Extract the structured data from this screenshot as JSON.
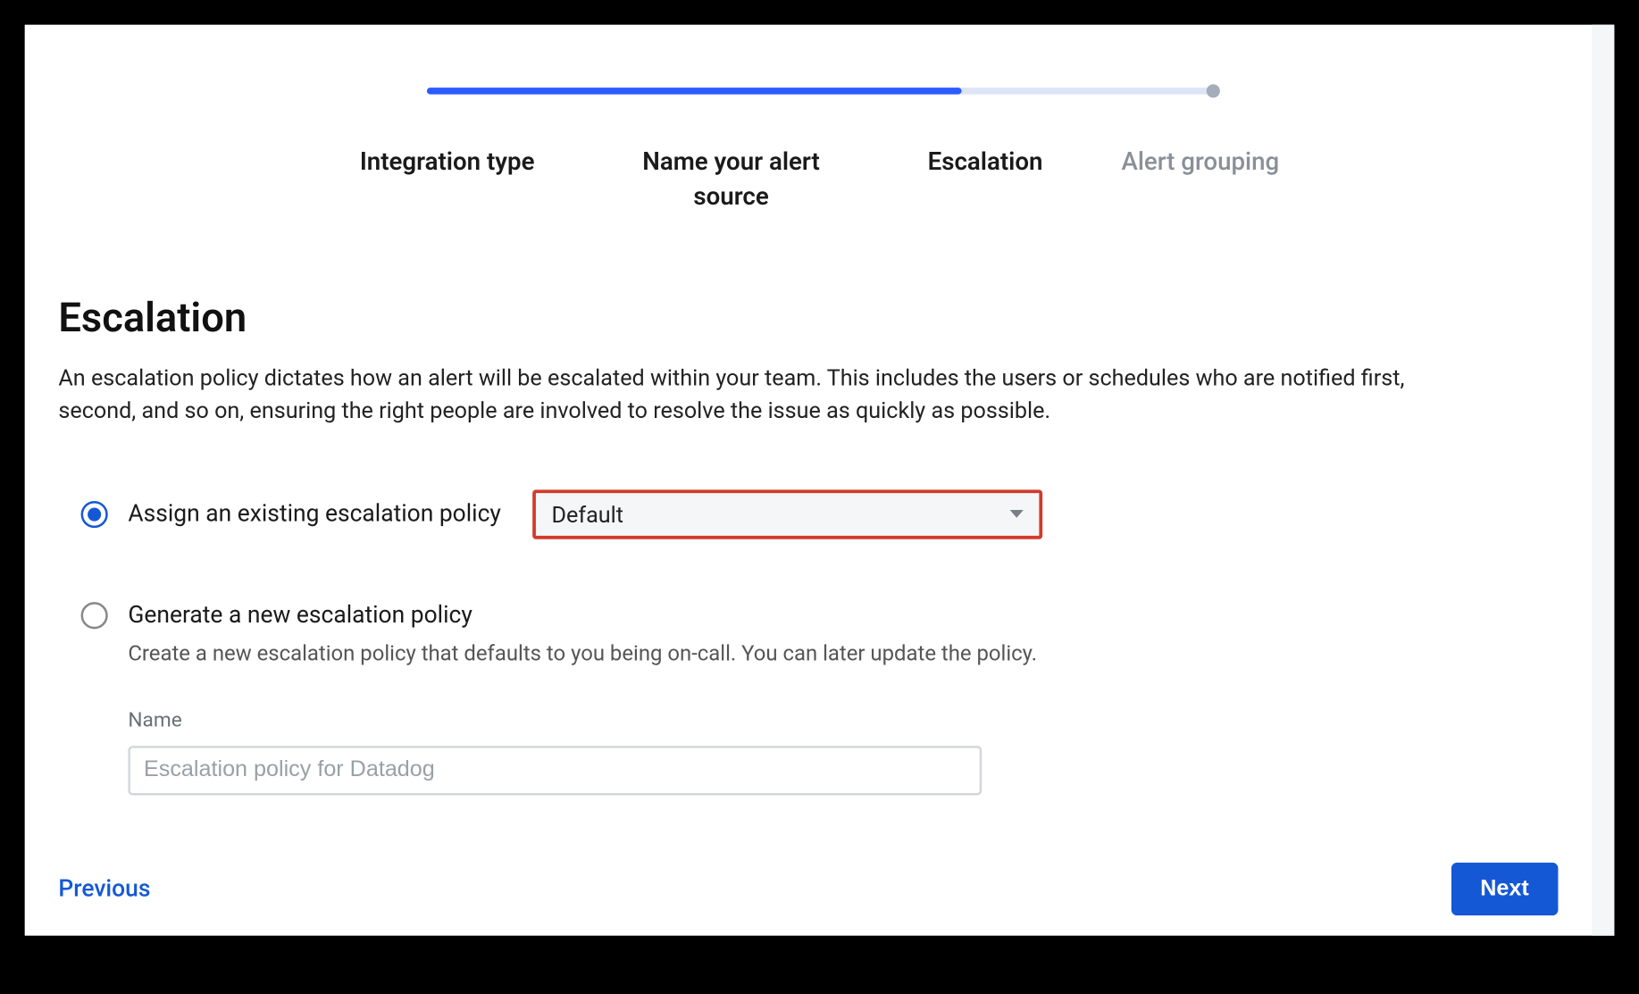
{
  "stepper": {
    "steps": [
      {
        "label": "Integration type",
        "active": true
      },
      {
        "label": "Name your alert source",
        "active": true
      },
      {
        "label": "Escalation",
        "active": true
      },
      {
        "label": "Alert grouping",
        "active": false
      }
    ]
  },
  "heading": {
    "title": "Escalation",
    "description": "An escalation policy dictates how an alert will be escalated within your team. This includes the users or schedules who are notified first, second, and so on, ensuring the right people are involved to resolve the issue as quickly as possible."
  },
  "options": {
    "assignExisting": {
      "label": "Assign an existing escalation policy",
      "selected": true,
      "selectValue": "Default"
    },
    "generateNew": {
      "label": "Generate a new escalation policy",
      "selected": false,
      "description": "Create a new escalation policy that defaults to you being on-call. You can later update the policy.",
      "nameFieldLabel": "Name",
      "namePlaceholder": "Escalation policy for Datadog"
    }
  },
  "footer": {
    "prev": "Previous",
    "next": "Next"
  }
}
